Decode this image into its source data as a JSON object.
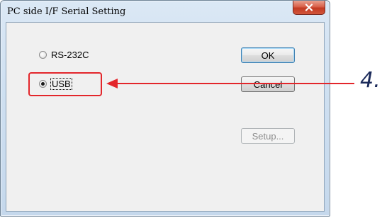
{
  "window": {
    "title": "PC side I/F Serial Setting",
    "close_icon": "close-icon"
  },
  "options": [
    {
      "label": "RS-232C",
      "selected": false
    },
    {
      "label": "USB",
      "selected": true
    }
  ],
  "buttons": {
    "ok": "OK",
    "cancel": "Cancel",
    "setup": "Setup..."
  },
  "annotation": {
    "step": "4.",
    "color": "#e3262b"
  }
}
